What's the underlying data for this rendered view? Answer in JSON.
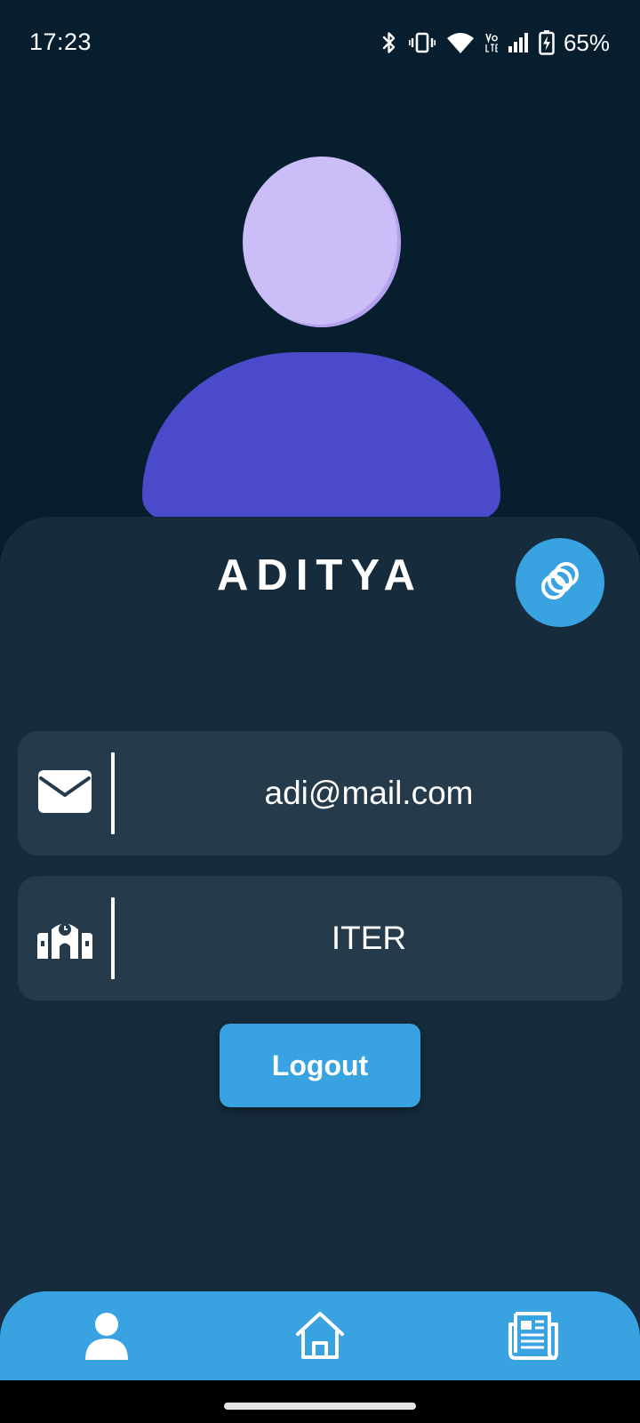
{
  "status_bar": {
    "time": "17:23",
    "battery": "65%",
    "icons": [
      "bluetooth-icon",
      "vibrate-icon",
      "wifi-icon",
      "volte-icon",
      "signal-icon",
      "battery-charging-icon"
    ]
  },
  "profile": {
    "name": "ADITYA",
    "avatar_colors": {
      "head": "#cbbdf8",
      "body": "#4b4acb"
    }
  },
  "link_button": {
    "icon": "link-rings-icon"
  },
  "info_rows": [
    {
      "icon": "mail-icon",
      "value": "adi@mail.com"
    },
    {
      "icon": "school-icon",
      "value": "ITER"
    }
  ],
  "logout": {
    "label": "Logout"
  },
  "bottom_nav": {
    "items": [
      {
        "icon": "profile-icon",
        "active": true
      },
      {
        "icon": "home-icon",
        "active": false
      },
      {
        "icon": "news-icon",
        "active": false
      }
    ]
  },
  "colors": {
    "background": "#061e2e",
    "card": "#162b3c",
    "row": "#253b4b",
    "accent": "#39a2e0"
  }
}
